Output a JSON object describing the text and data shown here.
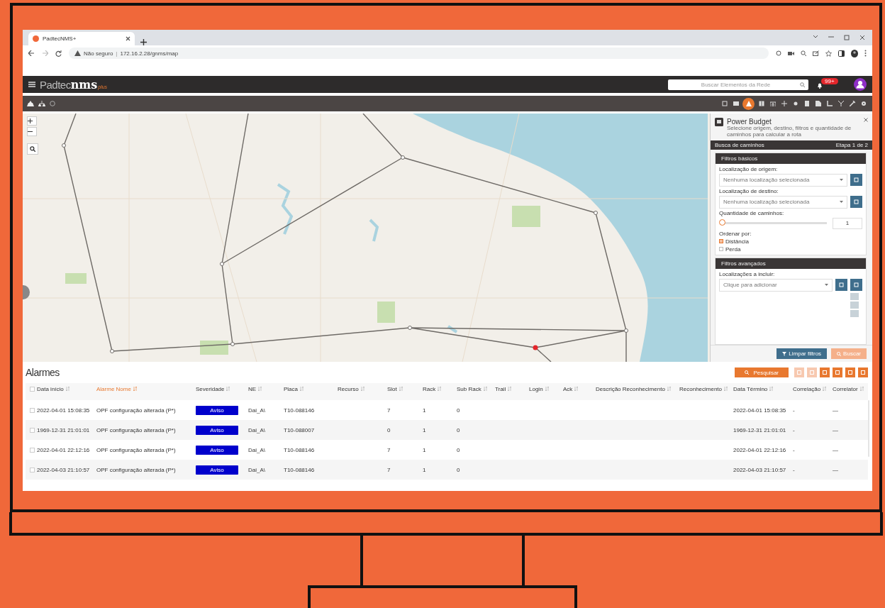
{
  "browser": {
    "tab_title": "PadtecNMS+",
    "address_warning": "Não seguro",
    "separator": "|",
    "url": "172.16.2.28/gnms/map"
  },
  "header": {
    "logo_light": "Padtec",
    "logo_bold": "nms",
    "logo_suffix": "plus",
    "search_placeholder": "Buscar Elementos da Rede",
    "notification_badge": "99+"
  },
  "toolbar": {
    "tools": [
      {
        "selected": false
      },
      {
        "selected": false
      },
      {
        "selected": true
      },
      {
        "selected": false
      },
      {
        "selected": false
      },
      {
        "selected": false
      },
      {
        "selected": false
      },
      {
        "selected": false
      },
      {
        "selected": false
      },
      {
        "selected": false
      },
      {
        "selected": false
      },
      {
        "selected": false
      },
      {
        "selected": false
      }
    ]
  },
  "power_budget": {
    "title": "Power Budget",
    "subtitle": "Selecione origem, destino, filtros e quantidade de caminhos para calcular a rota",
    "section_bar": "Busca de caminhos",
    "step": "Etapa 1 de 2",
    "basic_filters": "Filtros básicos",
    "origin_label": "Localização de origem:",
    "origin_placeholder": "Nenhuma localização selecionada",
    "dest_label": "Localização de destino:",
    "dest_placeholder": "Nenhuma localização selecionada",
    "paths_label": "Quantidade de caminhos:",
    "paths_slider": {
      "level": 0
    },
    "paths_value": "1",
    "order_label": "Ordenar por:",
    "order_options": [
      {
        "label": "Distância",
        "selected": true
      },
      {
        "label": "Perda",
        "selected": false
      }
    ],
    "advanced_filters": "Filtros avançados",
    "include_label": "Localizações a incluir:",
    "include_placeholder": "Clique para adicionar",
    "clear_button": "Limpar filtros",
    "search_button": "Buscar"
  },
  "alarms": {
    "title": "Alarmes",
    "search_button": "Pesquisar",
    "select_all_checked": false,
    "actions": [
      {
        "disabled": true
      },
      {
        "disabled": true
      },
      {
        "disabled": false
      },
      {
        "disabled": false
      },
      {
        "disabled": false
      },
      {
        "disabled": false
      }
    ],
    "columns": [
      {
        "label": "Data início",
        "sorted": false
      },
      {
        "label": "Alarme Nome",
        "sorted": true
      },
      {
        "label": "Severidade",
        "sorted": false
      },
      {
        "label": "NE",
        "sorted": false
      },
      {
        "label": "Placa",
        "sorted": false
      },
      {
        "label": "Recurso",
        "sorted": false
      },
      {
        "label": "Slot",
        "sorted": false
      },
      {
        "label": "Rack",
        "sorted": false
      },
      {
        "label": "Sub Rack",
        "sorted": false
      },
      {
        "label": "Trail",
        "sorted": false
      },
      {
        "label": "Login",
        "sorted": false
      },
      {
        "label": "Ack",
        "sorted": false
      },
      {
        "label": "Descrição Reconhecimento",
        "sorted": false
      },
      {
        "label": "Reconhecimento",
        "sorted": false
      },
      {
        "label": "Data Término",
        "sorted": false
      },
      {
        "label": "Correlação",
        "sorted": false
      },
      {
        "label": "Correlator",
        "sorted": false
      }
    ],
    "rows": [
      {
        "checked": false,
        "start": "2022-04-01 15:08:35",
        "name": "OPF configuração alterada (P*)",
        "severity": "Aviso",
        "color": "#0000cc",
        "ne": "Dai_A\\",
        "board": "T10-088146",
        "slot": "7",
        "rack": "1",
        "subrack": "0",
        "end": "2022-04-01 15:08:35",
        "correlation": "-",
        "correlator": "—"
      },
      {
        "checked": false,
        "start": "1969-12-31 21:01:01",
        "name": "OPF configuração alterada (P*)",
        "severity": "Aviso",
        "color": "#0000cc",
        "ne": "Dai_A\\",
        "board": "T10-088007",
        "slot": "0",
        "rack": "1",
        "subrack": "0",
        "end": "1969-12-31 21:01:01",
        "correlation": "-",
        "correlator": "—"
      },
      {
        "checked": false,
        "start": "2022-04-01 22:12:16",
        "name": "OPF configuração alterada (P*)",
        "severity": "Aviso",
        "color": "#0000cc",
        "ne": "Dai_A\\",
        "board": "T10-088146",
        "slot": "7",
        "rack": "1",
        "subrack": "0",
        "end": "2022-04-01 22:12:16",
        "correlation": "-",
        "correlator": "—"
      },
      {
        "checked": false,
        "start": "2022-04-03 21:10:57",
        "name": "OPF configuração alterada (P*)",
        "severity": "Aviso",
        "color": "#0000cc",
        "ne": "Dai_A\\",
        "board": "T10-088146",
        "slot": "7",
        "rack": "1",
        "subrack": "0",
        "end": "2022-04-03 21:10:57",
        "correlation": "-",
        "correlator": "—"
      }
    ]
  }
}
